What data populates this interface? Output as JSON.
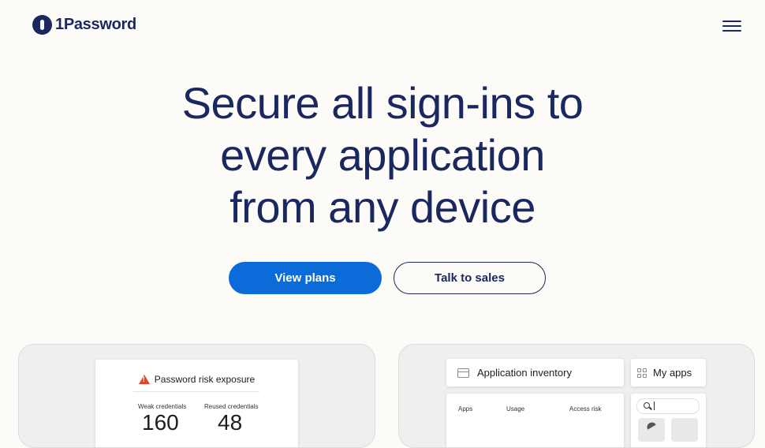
{
  "header": {
    "brand": "1Password",
    "menu_icon": "hamburger-menu-icon"
  },
  "hero": {
    "headline_lines": [
      "Secure all sign-ins to",
      "every application",
      "from any device"
    ]
  },
  "cta": {
    "primary_label": "View plans",
    "secondary_label": "Talk to sales"
  },
  "risk_card": {
    "title": "Password risk exposure",
    "stats": [
      {
        "label": "Weak credentials",
        "value": "160"
      },
      {
        "label": "Reused credentials",
        "value": "48"
      }
    ]
  },
  "inventory": {
    "title": "Application inventory",
    "my_apps_title": "My apps",
    "columns": [
      "Apps",
      "Usage",
      "Access risk"
    ]
  },
  "colors": {
    "background": "#fcfbf7",
    "brand_navy": "#1a285f",
    "primary_blue": "#0a6bd9",
    "warning_red": "#e0442c"
  }
}
